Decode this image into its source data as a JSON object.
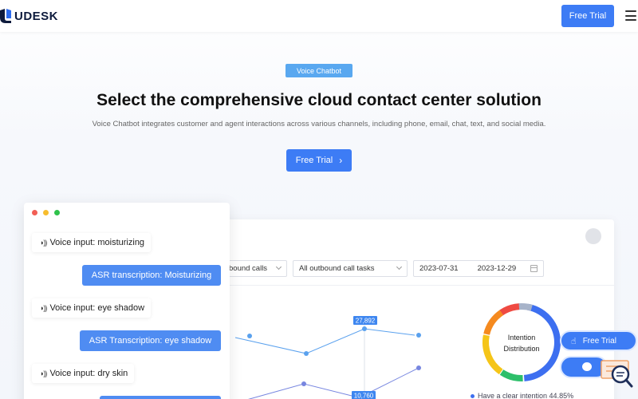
{
  "header": {
    "logo_text": "UDESK",
    "cta_label": "Free Trial",
    "menu_icon": "hamburger-menu-icon"
  },
  "hero": {
    "tag": "Voice Chatbot",
    "title": "Select the comprehensive cloud contact center solution",
    "subtitle": "Voice Chatbot integrates customer and agent interactions across various channels, including phone, email, chat, text, and social media.",
    "cta_label": "Free Trial"
  },
  "dashboard": {
    "filter_calls": "bound calls",
    "filter_tasks": "All outbound call tasks",
    "date_start": "2023-07-31",
    "date_end": "2023-12-29",
    "chart_labels": [
      "27,892",
      "10,760"
    ],
    "donut_title_1": "Intention",
    "donut_title_2": "Distribution",
    "legend_text": "Have a clear intention 44.85%"
  },
  "chat": {
    "messages": [
      {
        "voice": "Voice input: moisturizing",
        "asr": "ASR transcription: Moisturizing"
      },
      {
        "voice": "Voice input: eye shadow",
        "asr": "ASR Transcription: eye shadow"
      },
      {
        "voice": "Voice input: dry skin"
      }
    ]
  },
  "widgets": {
    "float_trial_label": "Free Trial"
  },
  "colors": {
    "primary": "#3d7cf5",
    "tag": "#59a8f0",
    "asr_bubble": "#4f8cf2",
    "donut": [
      "#3d6ff0",
      "#2dbf6a",
      "#f5c518",
      "#f58a1f",
      "#ef4a42",
      "#a7b3c9"
    ]
  }
}
